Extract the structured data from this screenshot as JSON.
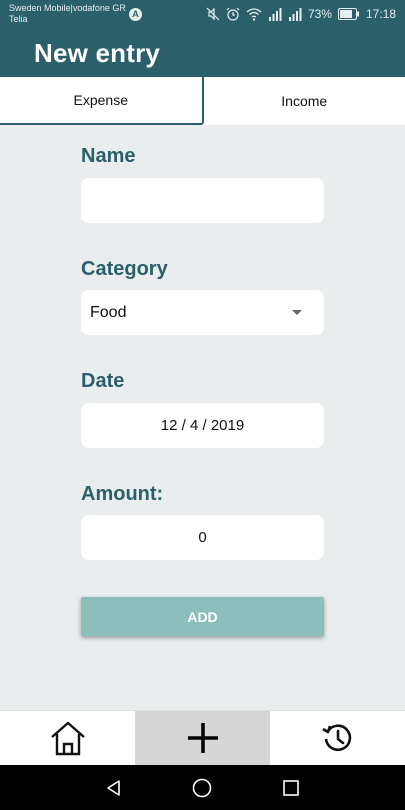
{
  "status_bar": {
    "carrier_line1": "Sweden Mobile|vodafone GR",
    "carrier_line2": "Telia",
    "carrier_app_letter": "A",
    "battery": "73%",
    "time": "17:18",
    "icons": [
      "mute-icon",
      "alarm-icon",
      "wifi-icon",
      "signal-icon",
      "signal-icon",
      "battery-icon"
    ]
  },
  "app_bar": {
    "title": "New entry"
  },
  "tabs": [
    {
      "label": "Expense",
      "active": true
    },
    {
      "label": "Income",
      "active": false
    }
  ],
  "form": {
    "name": {
      "label": "Name",
      "value": ""
    },
    "category": {
      "label": "Category",
      "value": "Food"
    },
    "date": {
      "label": "Date",
      "value": "12 / 4 / 2019"
    },
    "amount": {
      "label": "Amount:",
      "value": "0"
    },
    "add_label": "ADD"
  },
  "bottom_nav": {
    "items": [
      {
        "icon": "home-icon",
        "active": false
      },
      {
        "icon": "plus-icon",
        "active": true
      },
      {
        "icon": "history-icon",
        "active": false
      }
    ]
  },
  "system_nav": {
    "icons": [
      "back-icon",
      "home-circle-icon",
      "recents-icon"
    ]
  },
  "colors": {
    "primary": "#2b5f6a",
    "button": "#8cbfbc",
    "background": "#e9edee",
    "active_nav": "#d6d6d6"
  }
}
